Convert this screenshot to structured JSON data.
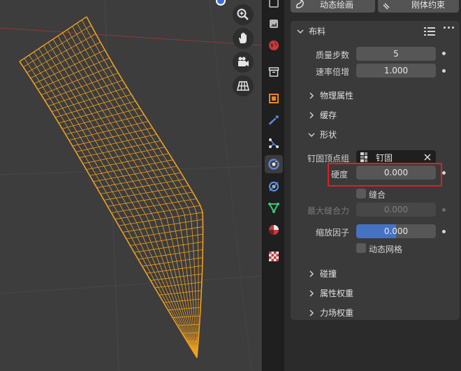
{
  "viewport": {
    "nav_buttons": [
      "zoom-icon",
      "hand-pan-icon",
      "camera-icon",
      "grid-perspective-icon"
    ]
  },
  "tabs": [
    "render-icon",
    "world-icon",
    "collection-icon",
    "object-icon",
    "modifier-wrench-icon",
    "particles-icon",
    "physics-icon",
    "constraints-icon",
    "data-icon",
    "material-icon",
    "texture-icon"
  ],
  "top_buttons": {
    "dynamic_paint": "动态绘画",
    "rigid_body_constraint": "刚体约束"
  },
  "cloth": {
    "title": "布料",
    "quality_label": "质量步数",
    "quality_value": "5",
    "speed_label": "速率倍增",
    "speed_value": "1.000",
    "physical_properties": "物理属性",
    "cache": "缓存",
    "shape": {
      "title": "形状",
      "pin_group_label": "钉固顶点组",
      "pin_group_value": "钉固",
      "stiffness_label": "硬度",
      "stiffness_value": "0.000",
      "sewing_label": "缝合",
      "max_sewing_label": "最大缝合力",
      "max_sewing_value": "0.000",
      "shrink_label": "缩放因子",
      "shrink_value": "0.000",
      "shrink_fill_fraction": 0.5,
      "dynamic_mesh_label": "动态网格"
    },
    "collisions": "碰撞",
    "property_weights": "属性权重",
    "field_weights": "力场权重"
  },
  "colors": {
    "mesh_orange": "#f0a020",
    "highlight_red": "#e02020",
    "accent_blue": "#4672c4"
  }
}
